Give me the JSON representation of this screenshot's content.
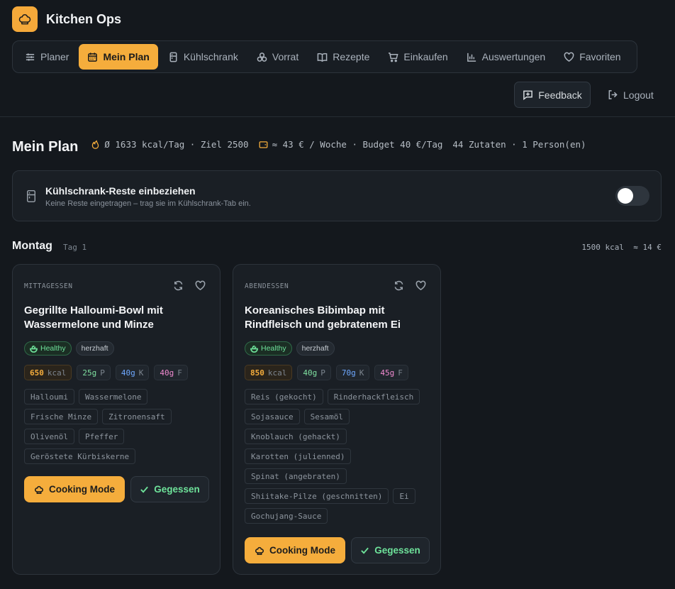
{
  "app": {
    "title": "Kitchen Ops",
    "logo_icon": "chef-hat-icon"
  },
  "nav": {
    "items": [
      {
        "label": "Planer",
        "icon": "sliders-icon",
        "active": false
      },
      {
        "label": "Mein Plan",
        "icon": "calendar-icon",
        "active": true
      },
      {
        "label": "Kühlschrank",
        "icon": "fridge-icon",
        "active": false
      },
      {
        "label": "Vorrat",
        "icon": "pantry-icon",
        "active": false
      },
      {
        "label": "Rezepte",
        "icon": "book-icon",
        "active": false
      },
      {
        "label": "Einkaufen",
        "icon": "cart-icon",
        "active": false
      },
      {
        "label": "Auswertungen",
        "icon": "bar-chart-icon",
        "active": false
      },
      {
        "label": "Favoriten",
        "icon": "heart-icon",
        "active": false
      }
    ]
  },
  "header": {
    "feedback_label": "Feedback",
    "logout_label": "Logout"
  },
  "page": {
    "title": "Mein Plan",
    "stats": {
      "calories": "Ø 1633 kcal/Tag · Ziel 2500",
      "budget": "≈ 43 € / Woche · Budget 40 €/Tag",
      "ingredients": "44 Zutaten · 1 Person(en)"
    }
  },
  "fridge": {
    "title": "Kühlschrank-Reste einbeziehen",
    "subtitle": "Keine Reste eingetragen – trag sie im Kühlschrank-Tab ein.",
    "enabled": false
  },
  "day": {
    "name": "Montag",
    "sub": "Tag 1",
    "kcal": "1500 kcal",
    "cost": "≈ 14 €"
  },
  "meals": [
    {
      "type": "MITTAGESSEN",
      "title": "Gegrillte Halloumi-Bowl mit Wassermelone und Minze",
      "tags": [
        "Healthy",
        "herzhaft"
      ],
      "macros": {
        "kcal": "650",
        "kcal_unit": "kcal",
        "p": "25g",
        "p_unit": "P",
        "k": "40g",
        "k_unit": "K",
        "f": "40g",
        "f_unit": "F"
      },
      "ingredients": [
        "Halloumi",
        "Wassermelone",
        "Frische Minze",
        "Zitronensaft",
        "Olivenöl",
        "Pfeffer",
        "Geröstete Kürbiskerne"
      ],
      "cook_label": "Cooking Mode",
      "eaten_label": "Gegessen"
    },
    {
      "type": "ABENDESSEN",
      "title": "Koreanisches Bibimbap mit Rindfleisch und gebratenem Ei",
      "tags": [
        "Healthy",
        "herzhaft"
      ],
      "macros": {
        "kcal": "850",
        "kcal_unit": "kcal",
        "p": "40g",
        "p_unit": "P",
        "k": "70g",
        "k_unit": "K",
        "f": "45g",
        "f_unit": "F"
      },
      "ingredients": [
        "Reis (gekocht)",
        "Rinderhackfleisch",
        "Sojasauce",
        "Sesamöl",
        "Knoblauch (gehackt)",
        "Karotten (julienned)",
        "Spinat (angebraten)",
        "Shiitake-Pilze (geschnitten)",
        "Ei",
        "Gochujang-Sauce"
      ],
      "cook_label": "Cooking Mode",
      "eaten_label": "Gegessen"
    }
  ],
  "colors": {
    "accent": "#f5ad3c",
    "background": "#14181d",
    "healthy": "#6ee29a",
    "protein": "#7fe0a0",
    "carbs": "#6ea8ff",
    "fat": "#f08ad0"
  }
}
